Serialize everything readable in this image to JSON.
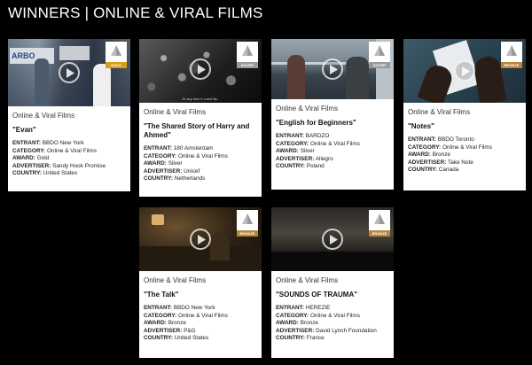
{
  "page": {
    "title": "WINNERS | ONLINE & VIRAL FILMS"
  },
  "labels": {
    "entrant": "ENTRANT:",
    "category": "CATEGORY:",
    "award": "AWARD:",
    "advertiser": "ADVERTISER:",
    "country": "COUNTRY:"
  },
  "colors": {
    "gold": "#d4a11e",
    "silver": "#9a9a9a",
    "bronze": "#b8863b"
  },
  "cards": [
    {
      "category_header": "Online & Viral Films",
      "title": "\"Evan\"",
      "entrant": "BBDO New York",
      "category": "Online & Viral Films",
      "award": "Gold",
      "advertiser": "Sandy Hook Promise",
      "country": "United States",
      "badge": "GOLD",
      "badge_icon": "pyramid-icon",
      "play_icon": "play-icon",
      "thumb_text": ""
    },
    {
      "category_header": "Online & Viral Films",
      "title": "\"The Shared Story of Harry and Ahmed\"",
      "entrant": "180 Amsterdam",
      "category": "Online & Viral Films",
      "award": "Silver",
      "advertiser": "Unicef",
      "country": "Netherlands",
      "badge": "SILVER",
      "badge_icon": "pyramid-icon",
      "play_icon": "play-icon",
      "thumb_text": "At any time it could flip."
    },
    {
      "category_header": "Online & Viral Films",
      "title": "\"English for Beginners\"",
      "entrant": "BARDZO",
      "category": "Online & Viral Films",
      "award": "Silver",
      "advertiser": "Allegro",
      "country": "Poland",
      "badge": "SILVER",
      "badge_icon": "pyramid-icon",
      "play_icon": "play-icon",
      "thumb_text": ""
    },
    {
      "category_header": "Online & Viral Films",
      "title": "\"Notes\"",
      "entrant": "BBDO Toronto",
      "category": "Online & Viral Films",
      "award": "Bronze",
      "advertiser": "Take Note",
      "country": "Canada",
      "badge": "BRONZE",
      "badge_icon": "pyramid-icon",
      "play_icon": "play-icon",
      "thumb_text": ""
    },
    {
      "category_header": "Online & Viral Films",
      "title": "\"The Talk\"",
      "entrant": "BBDO New York",
      "category": "Online & Viral Films",
      "award": "Bronze",
      "advertiser": "P&G",
      "country": "United States",
      "badge": "BRONZE",
      "badge_icon": "pyramid-icon",
      "play_icon": "play-icon",
      "thumb_text": ""
    },
    {
      "category_header": "Online & Viral Films",
      "title": "\"SOUNDS OF TRAUMA\"",
      "entrant": "HEREZIE",
      "category": "Online & Viral Films",
      "award": "Bronze",
      "advertiser": "David Lynch Foundation",
      "country": "France",
      "badge": "BRONZE",
      "badge_icon": "pyramid-icon",
      "play_icon": "play-icon",
      "thumb_text": ""
    }
  ]
}
